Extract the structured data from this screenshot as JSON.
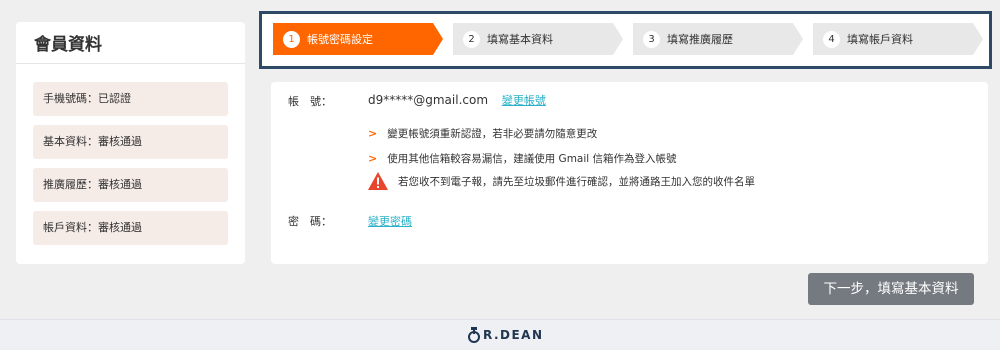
{
  "sidebar": {
    "title": "會員資料",
    "items": [
      {
        "label": "手機號碼：已認證"
      },
      {
        "label": "基本資料：審核通過"
      },
      {
        "label": "推廣履歷：審核通過"
      },
      {
        "label": "帳戶資料：審核通過"
      }
    ]
  },
  "steps": [
    {
      "num": "1",
      "label": "帳號密碼設定",
      "active": true
    },
    {
      "num": "2",
      "label": "填寫基本資料",
      "active": false
    },
    {
      "num": "3",
      "label": "填寫推廣履歷",
      "active": false
    },
    {
      "num": "4",
      "label": "填寫帳戶資料",
      "active": false
    }
  ],
  "account": {
    "label": "帳　號：",
    "email": "d9*****@gmail.com",
    "change_link": "變更帳號",
    "notes": [
      "變更帳號須重新認證，若非必要請勿隨意更改",
      "使用其他信箱較容易漏信，建議使用 Gmail 信箱作為登入帳號"
    ],
    "warning": "若您收不到電子報，請先至垃圾郵件進行確認，並將通路王加入您的收件名單"
  },
  "password": {
    "label": "密　碼：",
    "change_link": "變更密碼"
  },
  "next_button": "下一步，填寫基本資料",
  "footer": {
    "logo_text": "R.DEAN"
  },
  "colors": {
    "accent": "#ff6600",
    "link": "#2ab0c7",
    "frame": "#2e4a66",
    "button": "#757a80"
  }
}
